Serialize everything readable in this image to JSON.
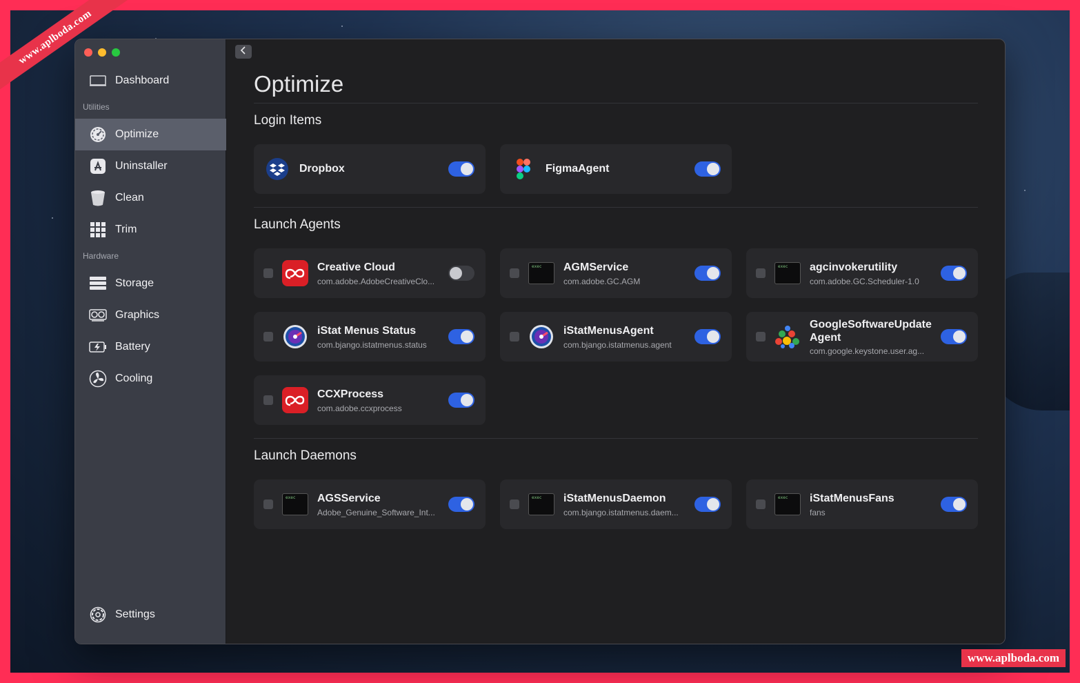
{
  "watermark": {
    "ribbon": "www.aplboda.com",
    "tag": "www.aplboda.com"
  },
  "sidebar": {
    "dashboard": {
      "label": "Dashboard",
      "icon": "display-icon"
    },
    "section_utilities": "Utilities",
    "utilities": [
      {
        "label": "Optimize",
        "icon": "gauge-icon",
        "active": true
      },
      {
        "label": "Uninstaller",
        "icon": "app-store-icon",
        "active": false
      },
      {
        "label": "Clean",
        "icon": "trash-icon",
        "active": false
      },
      {
        "label": "Trim",
        "icon": "grid-icon",
        "active": false
      }
    ],
    "section_hardware": "Hardware",
    "hardware": [
      {
        "label": "Storage",
        "icon": "storage-icon"
      },
      {
        "label": "Graphics",
        "icon": "graphics-card-icon"
      },
      {
        "label": "Battery",
        "icon": "battery-icon"
      },
      {
        "label": "Cooling",
        "icon": "fan-icon"
      }
    ],
    "settings": {
      "label": "Settings",
      "icon": "gear-icon"
    }
  },
  "main": {
    "title": "Optimize",
    "login_items": {
      "title": "Login Items",
      "items": [
        {
          "name": "Dropbox",
          "icon": "dropbox-icon",
          "enabled": true
        },
        {
          "name": "FigmaAgent",
          "icon": "figma-icon",
          "enabled": true
        }
      ]
    },
    "launch_agents": {
      "title": "Launch Agents",
      "items": [
        {
          "name": "Creative Cloud",
          "sub": "com.adobe.AdobeCreativeClo...",
          "icon": "creative-cloud-icon",
          "enabled": false
        },
        {
          "name": "AGMService",
          "sub": "com.adobe.GC.AGM",
          "icon": "exec-icon",
          "enabled": true
        },
        {
          "name": "agcinvokerutility",
          "sub": "com.adobe.GC.Scheduler-1.0",
          "icon": "exec-icon",
          "enabled": true
        },
        {
          "name": "iStat Menus Status",
          "sub": "com.bjango.istatmenus.status",
          "icon": "istat-icon",
          "enabled": true
        },
        {
          "name": "iStatMenusAgent",
          "sub": "com.bjango.istatmenus.agent",
          "icon": "istat-icon",
          "enabled": true
        },
        {
          "name": "GoogleSoftwareUpdate Agent",
          "sub": "com.google.keystone.user.ag...",
          "icon": "google-update-icon",
          "enabled": true
        },
        {
          "name": "CCXProcess",
          "sub": "com.adobe.ccxprocess",
          "icon": "creative-cloud-icon",
          "enabled": true
        }
      ]
    },
    "launch_daemons": {
      "title": "Launch Daemons",
      "items": [
        {
          "name": "AGSService",
          "sub": "Adobe_Genuine_Software_Int...",
          "icon": "exec-icon",
          "enabled": true
        },
        {
          "name": "iStatMenusDaemon",
          "sub": "com.bjango.istatmenus.daem...",
          "icon": "exec-icon",
          "enabled": true
        },
        {
          "name": "iStatMenusFans",
          "sub": "fans",
          "icon": "exec-icon",
          "enabled": true
        }
      ]
    },
    "exec_label": "exec"
  },
  "colors": {
    "accent": "#2e62e2",
    "sidebar_bg": "#3a3d46",
    "main_bg": "#1f1f21",
    "frame": "#ff2d55"
  }
}
